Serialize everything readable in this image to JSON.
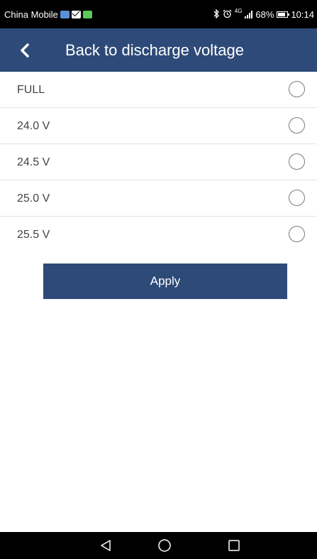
{
  "status_bar": {
    "carrier": "China Mobile",
    "left_icons": [
      "weather-icon",
      "mail-icon",
      "app-notification-icon"
    ],
    "right_icons": [
      "bluetooth-icon",
      "alarm-icon",
      "signal-icon",
      "battery-icon"
    ],
    "network_label": "4G",
    "battery_percent": "68%",
    "time": "10:14"
  },
  "header": {
    "back_icon": "chevron-left-icon",
    "title": "Back to discharge voltage"
  },
  "options": [
    {
      "label": "FULL",
      "selected": false
    },
    {
      "label": "24.0 V",
      "selected": false
    },
    {
      "label": "24.5 V",
      "selected": false
    },
    {
      "label": "25.0 V",
      "selected": false
    },
    {
      "label": "25.5 V",
      "selected": false
    }
  ],
  "apply_label": "Apply",
  "nav_bar": {
    "icons": [
      "back-triangle-icon",
      "home-circle-icon",
      "recents-square-icon"
    ]
  },
  "colors": {
    "primary": "#2e4a78",
    "status_bar": "#000000",
    "background": "#ffffff",
    "divider": "#e3e3e3",
    "text": "#444444"
  }
}
